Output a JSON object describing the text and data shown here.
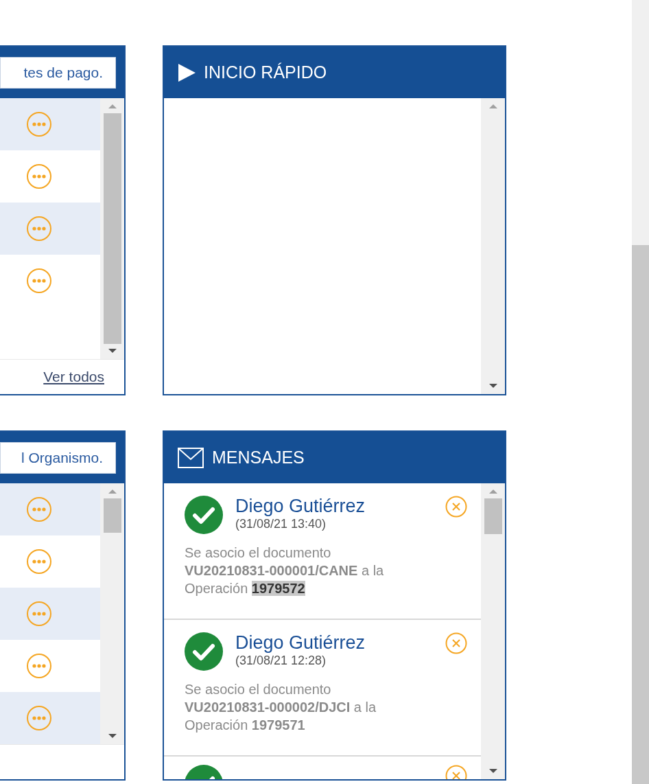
{
  "left_panels": [
    {
      "field_text": "tes de pago.",
      "rows": [
        {
          "shaded": true
        },
        {
          "shaded": false
        },
        {
          "shaded": true
        },
        {
          "shaded": false
        }
      ],
      "footer_link": "Ver todos"
    },
    {
      "field_text": "l Organismo.",
      "rows": [
        {
          "shaded": true
        },
        {
          "shaded": false
        },
        {
          "shaded": true
        },
        {
          "shaded": false
        },
        {
          "shaded": true
        }
      ]
    }
  ],
  "quick_start": {
    "title": "INICIO RÁPIDO"
  },
  "messages_panel": {
    "title": "MENSAJES",
    "messages": [
      {
        "sender": "Diego Gutiérrez",
        "time": "(31/08/21 13:40)",
        "body": "Se asocio el documento **VU20210831-000001/CANE** a la Operación **1979572**",
        "operation_highlighted": true
      },
      {
        "sender": "Diego Gutiérrez",
        "time": "(31/08/21 12:28)",
        "body": "Se asocio el documento **VU20210831-000002/DJCI** a la Operación **1979571**",
        "operation_highlighted": false
      }
    ]
  }
}
